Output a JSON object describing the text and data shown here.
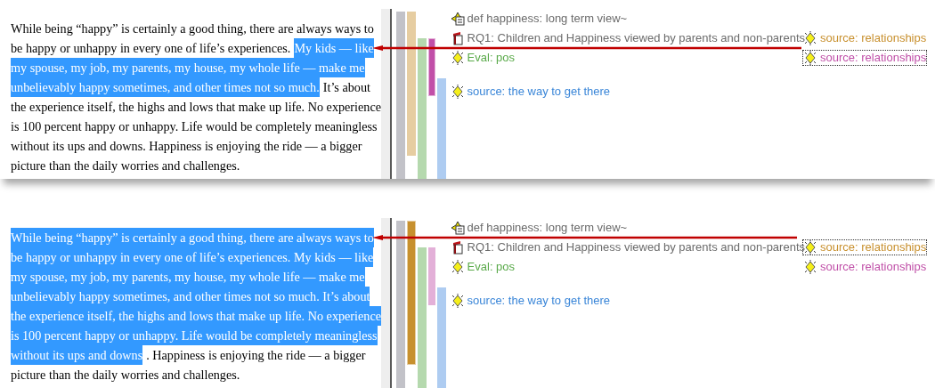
{
  "panels": [
    {
      "lines": [
        {
          "segments": [
            {
              "text": "While being “happy” is certainly a good thing, there are always ways to",
              "selected": false
            }
          ]
        },
        {
          "segments": [
            {
              "text": "be happy or unhappy in every one of life’s experiences.",
              "selected": false
            },
            {
              "text": "My kids — like",
              "selected": true
            }
          ]
        },
        {
          "segments": [
            {
              "text": "my spouse, my job, my parents, my house, my whole life — make me",
              "selected": true
            }
          ]
        },
        {
          "segments": [
            {
              "text": "unbelievably happy sometimes, and other times not so much.",
              "selected": true
            },
            {
              "text": "It’s about",
              "selected": false
            }
          ]
        },
        {
          "segments": [
            {
              "text": "the experience itself, the highs and lows that make up life. No experience",
              "selected": false
            }
          ]
        },
        {
          "segments": [
            {
              "text": "is 100 percent happy or unhappy. Life would be completely meaningless",
              "selected": false
            }
          ]
        },
        {
          "segments": [
            {
              "text": "without its ups and downs. Happiness is enjoying the ride — a bigger",
              "selected": false
            }
          ]
        },
        {
          "segments": [
            {
              "text": "picture than the daily worries and challenges.",
              "selected": false
            }
          ]
        }
      ],
      "bars": [
        {
          "color": "#c2c2c8",
          "active": false
        },
        {
          "color": "#e6cda1",
          "active": false
        },
        {
          "color": "#b5d9ae",
          "active": false
        },
        {
          "color": "#e3b0d8",
          "active": true
        },
        {
          "color": "#aeccf1",
          "active": false
        }
      ],
      "rows": [
        {
          "codes": [
            {
              "kind": "memo",
              "label": "def happiness: long term view~",
              "color": "#6b6b6b",
              "focused": false
            }
          ]
        },
        {
          "codes": [
            {
              "kind": "document",
              "label": "RQ1: Children and Happiness viewed by parents and non-parents",
              "color": "#6b6b6b",
              "focused": false
            },
            {
              "kind": "code",
              "label": "source: relationships",
              "color": "#c8902e",
              "focused": false
            }
          ]
        },
        {
          "codes": [
            {
              "kind": "code",
              "label": "Eval: pos",
              "color": "#5aaa4a",
              "focused": false
            },
            {
              "kind": "code",
              "label": "source: relationships",
              "color": "#c050a8",
              "focused": true
            }
          ]
        },
        {
          "codes": [
            {
              "kind": "code",
              "label": "source: the way to get there",
              "color": "#3a86d8",
              "focused": false
            }
          ]
        }
      ]
    },
    {
      "lines": [
        {
          "segments": [
            {
              "text": "While being “happy” is certainly a good thing, there are always ways to",
              "selected": true
            }
          ]
        },
        {
          "segments": [
            {
              "text": "be happy or unhappy in every one of life’s experiences. My kids — like",
              "selected": true
            }
          ]
        },
        {
          "segments": [
            {
              "text": "my spouse, my job, my parents, my house, my whole life — make me",
              "selected": true
            }
          ]
        },
        {
          "segments": [
            {
              "text": "unbelievably happy sometimes, and other times not so much. It’s about",
              "selected": true
            }
          ]
        },
        {
          "segments": [
            {
              "text": "the experience itself, the highs and lows that make up life. No experience",
              "selected": true
            }
          ]
        },
        {
          "segments": [
            {
              "text": "is 100 percent happy or unhappy. Life would be completely meaningless",
              "selected": true
            }
          ]
        },
        {
          "segments": [
            {
              "text": "without its ups and downs",
              "selected": true
            },
            {
              "text": ". Happiness is enjoying the ride — a bigger",
              "selected": false
            }
          ]
        },
        {
          "segments": [
            {
              "text": "picture than the daily worries and challenges.",
              "selected": false
            }
          ]
        }
      ],
      "bars": [
        {
          "color": "#c2c2c8",
          "active": false
        },
        {
          "color": "#e6cda1",
          "active": true
        },
        {
          "color": "#b5d9ae",
          "active": false
        },
        {
          "color": "#e3b0d8",
          "active": false
        },
        {
          "color": "#aeccf1",
          "active": false
        }
      ],
      "rows": [
        {
          "codes": [
            {
              "kind": "memo",
              "label": "def happiness: long term view~",
              "color": "#6b6b6b",
              "focused": false
            }
          ]
        },
        {
          "codes": [
            {
              "kind": "document",
              "label": "RQ1: Children and Happiness viewed by parents and non-parents",
              "color": "#6b6b6b",
              "focused": false
            },
            {
              "kind": "code",
              "label": "source: relationships",
              "color": "#c8902e",
              "focused": true
            }
          ]
        },
        {
          "codes": [
            {
              "kind": "code",
              "label": "Eval: pos",
              "color": "#5aaa4a",
              "focused": false
            },
            {
              "kind": "code",
              "label": "source: relationships",
              "color": "#c050a8",
              "focused": false
            }
          ]
        },
        {
          "codes": [
            {
              "kind": "code",
              "label": "source: the way to get there",
              "color": "#3a86d8",
              "focused": false
            }
          ]
        }
      ]
    }
  ]
}
